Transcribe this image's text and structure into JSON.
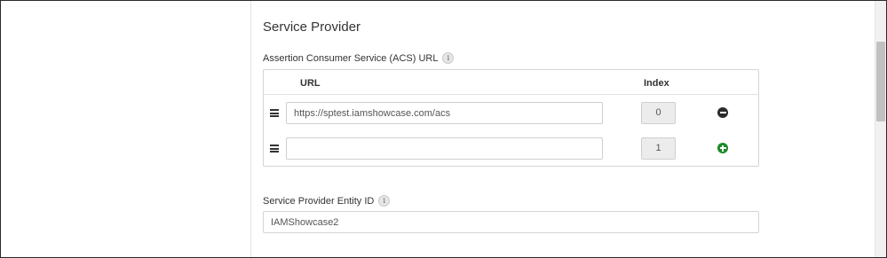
{
  "section": {
    "title": "Service Provider"
  },
  "acs": {
    "label": "Assertion Consumer Service (ACS) URL",
    "info_icon": "info-icon",
    "columns": {
      "url": "URL",
      "index": "Index"
    },
    "rows": [
      {
        "url": "https://sptest.iamshowcase.com/acs",
        "index": "0",
        "action": "remove-icon"
      },
      {
        "url": "",
        "index": "1",
        "action": "add-icon"
      }
    ]
  },
  "entity": {
    "label": "Service Provider Entity ID",
    "info_icon": "info-icon",
    "value": "IAMShowcase2"
  },
  "colors": {
    "add": "#1d8a2a",
    "remove": "#2b2b2b",
    "border": "#d4d4d4",
    "index_bg": "#ececec"
  }
}
